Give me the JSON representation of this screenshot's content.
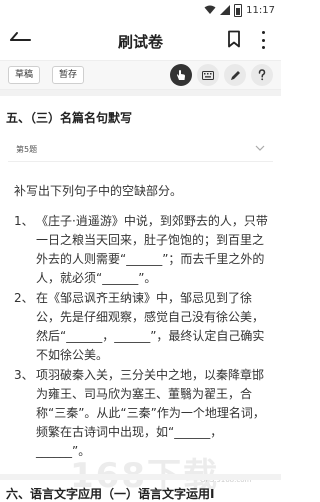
{
  "status_bar": {
    "time": "11:17"
  },
  "header": {
    "title": "刷试卷"
  },
  "toolbar": {
    "draft_label": "草稿",
    "save_label": "暂存"
  },
  "section5": {
    "heading": "五、（三）名篇名句默写"
  },
  "question": {
    "number_label": "第5题",
    "instruction": "补写出下列句子中的空缺部分。",
    "items": [
      {
        "num": "1、",
        "text": "《庄子·逍遥游》中说，到郊野去的人，只带一日之粮当天回来，肚子饱饱的；到百里之外去的人则需要“______”；而去千里之外的人，就必须“______”。"
      },
      {
        "num": "2、",
        "text": "在《邹忌讽齐王纳谏》中，邹忌见到了徐公，先是仔细观察，感觉自己没有徐公美，然后“______，______”，最终认定自己确实不如徐公美。"
      },
      {
        "num": "3、",
        "text": "项羽破秦入关，三分关中之地，以秦降章邯为雍王、司马欣为塞王、董翳为翟王，合称“三秦”。从此“三秦”作为一个地理名词，频繁在古诗词中出现，如“______，______”。"
      }
    ]
  },
  "section6": {
    "heading": "六、语言文字应用（一）语言文字运用Ⅰ"
  },
  "watermark": {
    "text": "168下载",
    "url": "GPS.9168.com"
  }
}
